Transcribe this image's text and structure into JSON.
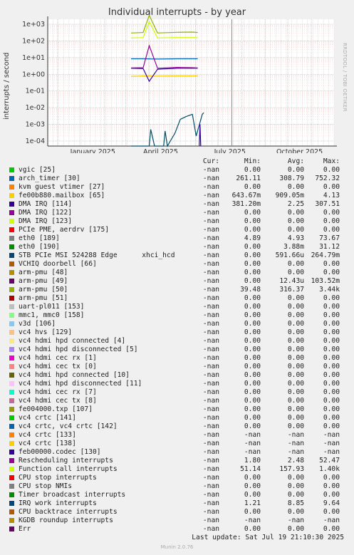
{
  "title": "Individual interrupts - by year",
  "side_label": "RRDTOOL / TOBI OETIKER",
  "ylabel": "interrupts / second",
  "columns": {
    "cur": "Cur:",
    "min": "Min:",
    "avg": "Avg:",
    "max": "Max:"
  },
  "last_update": "Last update: Sat Jul 19 21:10:30 2025",
  "footer": "Munin 2.0.76",
  "chart_data": {
    "type": "line",
    "title": "Individual interrupts - by year",
    "ylabel": "interrupts / second",
    "y_scale": "log",
    "ylim": [
      5e-05,
      2000
    ],
    "y_ticks": [
      "1e-04",
      "1e-03",
      "1e-02",
      "1e-01",
      "1e+00",
      "1e+01",
      "1e+02",
      "1e+03"
    ],
    "y_tick_values": [
      0.0001,
      0.001,
      0.01,
      0.1,
      1,
      10,
      100,
      1000
    ],
    "x_ticks": [
      "January 2025",
      "April 2025",
      "July 2025",
      "October 2025"
    ],
    "grid": true,
    "series": [
      {
        "name": "arch_timer [30]",
        "color": "#0066b3",
        "points": [
          [
            "2025-03-08",
            8.5
          ],
          [
            "2025-03-24",
            8.5
          ],
          [
            "2025-04-12",
            8.2
          ],
          [
            "2025-05-08",
            8.5
          ],
          [
            "2025-05-28",
            8.5
          ],
          [
            "2025-06-04",
            8.5
          ]
        ]
      },
      {
        "name": "fe00b880.mailbox [65]",
        "color": "#ffcc00",
        "points": [
          [
            "2025-03-08",
            0.75
          ],
          [
            "2025-03-24",
            0.8
          ],
          [
            "2025-04-12",
            0.78
          ],
          [
            "2025-05-08",
            0.8
          ],
          [
            "2025-05-28",
            0.8
          ],
          [
            "2025-06-04",
            0.8
          ]
        ]
      },
      {
        "name": "DMA IRQ [114]",
        "color": "#330099",
        "points": [
          [
            "2025-03-08",
            2.3
          ],
          [
            "2025-03-24",
            2.2
          ],
          [
            "2025-04-01",
            0.38
          ],
          [
            "2025-04-12",
            2.0
          ],
          [
            "2025-05-08",
            2.3
          ],
          [
            "2025-05-28",
            2.3
          ],
          [
            "2025-06-04",
            2.3
          ]
        ]
      },
      {
        "name": "arm-pmu [50]",
        "color": "#8fb300",
        "points": [
          [
            "2025-03-08",
            300
          ],
          [
            "2025-03-24",
            320
          ],
          [
            "2025-04-01",
            3440
          ],
          [
            "2025-04-12",
            300
          ],
          [
            "2025-05-08",
            330
          ],
          [
            "2025-05-28",
            340
          ],
          [
            "2025-06-04",
            320
          ]
        ]
      },
      {
        "name": "Function call interrupts",
        "color": "#ccff00",
        "points": [
          [
            "2025-03-08",
            150
          ],
          [
            "2025-03-24",
            160
          ],
          [
            "2025-04-01",
            1400
          ],
          [
            "2025-04-12",
            150
          ],
          [
            "2025-05-08",
            160
          ],
          [
            "2025-05-28",
            160
          ],
          [
            "2025-06-04",
            155
          ]
        ]
      },
      {
        "name": "Rescheduling interrupts",
        "color": "#990099",
        "points": [
          [
            "2025-03-08",
            2.4
          ],
          [
            "2025-03-24",
            2.5
          ],
          [
            "2025-04-01",
            52
          ],
          [
            "2025-04-12",
            2.3
          ],
          [
            "2025-05-08",
            2.6
          ],
          [
            "2025-05-28",
            2.5
          ],
          [
            "2025-06-04",
            2.4
          ]
        ]
      },
      {
        "name": "STB PCIe MSI 524288 Edge      xhci_hcd",
        "color": "#004d66",
        "points": [
          [
            "2025-03-08",
            5e-05
          ],
          [
            "2025-04-01",
            5e-05
          ],
          [
            "2025-04-03",
            0.0005
          ],
          [
            "2025-04-08",
            5e-05
          ],
          [
            "2025-04-20",
            5e-05
          ],
          [
            "2025-04-22",
            0.0004
          ],
          [
            "2025-04-25",
            5e-05
          ],
          [
            "2025-05-05",
            0.0003
          ],
          [
            "2025-05-12",
            0.002
          ],
          [
            "2025-05-20",
            0.003
          ],
          [
            "2025-05-28",
            0.004
          ],
          [
            "2025-06-02",
            0.0002
          ],
          [
            "2025-06-10",
            0.004
          ],
          [
            "2025-06-12",
            0.005
          ]
        ]
      },
      {
        "name": "arm-pmu [49]",
        "color": "#330099",
        "points": [
          [
            "2025-06-06",
            5e-05
          ],
          [
            "2025-06-07",
            0.001
          ],
          [
            "2025-06-08",
            5e-05
          ]
        ]
      }
    ]
  },
  "legend": [
    {
      "name": "vgic [25]",
      "color": "#00cc00",
      "cur": "-nan",
      "min": "0.00",
      "avg": "0.00",
      "max": "0.00"
    },
    {
      "name": "arch_timer [30]",
      "color": "#0066b3",
      "cur": "-nan",
      "min": "261.11",
      "avg": "308.79",
      "max": "752.32"
    },
    {
      "name": "kvm guest vtimer [27]",
      "color": "#ff8000",
      "cur": "-nan",
      "min": "0.00",
      "avg": "0.00",
      "max": "0.00"
    },
    {
      "name": "fe00b880.mailbox [65]",
      "color": "#ffcc00",
      "cur": "-nan",
      "min": "643.67m",
      "avg": "909.05m",
      "max": "4.13"
    },
    {
      "name": "DMA IRQ [114]",
      "color": "#330099",
      "cur": "-nan",
      "min": "381.20m",
      "avg": "2.25",
      "max": "307.51"
    },
    {
      "name": "DMA IRQ [122]",
      "color": "#990099",
      "cur": "-nan",
      "min": "0.00",
      "avg": "0.00",
      "max": "0.00"
    },
    {
      "name": "DMA IRQ [123]",
      "color": "#ccff00",
      "cur": "-nan",
      "min": "0.00",
      "avg": "0.00",
      "max": "0.00"
    },
    {
      "name": "PCIe PME, aerdrv [175]",
      "color": "#ff0000",
      "cur": "-nan",
      "min": "0.00",
      "avg": "0.00",
      "max": "0.00"
    },
    {
      "name": "eth0 [189]",
      "color": "#808080",
      "cur": "-nan",
      "min": "4.89",
      "avg": "4.93",
      "max": "73.67"
    },
    {
      "name": "eth0 [190]",
      "color": "#008f00",
      "cur": "-nan",
      "min": "0.00",
      "avg": "3.88m",
      "max": "31.12"
    },
    {
      "name": "STB PCIe MSI 524288 Edge      xhci_hcd",
      "color": "#00487d",
      "cur": "-nan",
      "min": "0.00",
      "avg": "591.66u",
      "max": "264.79m"
    },
    {
      "name": "VCHIQ doorbell [66]",
      "color": "#b35a00",
      "cur": "-nan",
      "min": "0.00",
      "avg": "0.00",
      "max": "0.00"
    },
    {
      "name": "arm-pmu [48]",
      "color": "#b38f00",
      "cur": "-nan",
      "min": "0.00",
      "avg": "0.00",
      "max": "0.00"
    },
    {
      "name": "arm-pmu [49]",
      "color": "#6b006b",
      "cur": "-nan",
      "min": "0.00",
      "avg": "12.43u",
      "max": "103.52m"
    },
    {
      "name": "arm-pmu [50]",
      "color": "#8fb300",
      "cur": "-nan",
      "min": "39.48",
      "avg": "316.37",
      "max": "3.44k"
    },
    {
      "name": "arm-pmu [51]",
      "color": "#b30000",
      "cur": "-nan",
      "min": "0.00",
      "avg": "0.00",
      "max": "0.00"
    },
    {
      "name": "uart-pl011 [153]",
      "color": "#bebebe",
      "cur": "-nan",
      "min": "0.00",
      "avg": "0.00",
      "max": "0.00"
    },
    {
      "name": "mmc1, mmc0 [158]",
      "color": "#80ff80",
      "cur": "-nan",
      "min": "0.00",
      "avg": "0.00",
      "max": "0.00"
    },
    {
      "name": "v3d [106]",
      "color": "#80c9ff",
      "cur": "-nan",
      "min": "0.00",
      "avg": "0.00",
      "max": "0.00"
    },
    {
      "name": "vc4 hvs [129]",
      "color": "#ffc080",
      "cur": "-nan",
      "min": "0.00",
      "avg": "0.00",
      "max": "0.00"
    },
    {
      "name": "vc4 hdmi hpd connected [4]",
      "color": "#ffe680",
      "cur": "-nan",
      "min": "0.00",
      "avg": "0.00",
      "max": "0.00"
    },
    {
      "name": "vc4 hdmi hpd disconnected [5]",
      "color": "#aa80ff",
      "cur": "-nan",
      "min": "0.00",
      "avg": "0.00",
      "max": "0.00"
    },
    {
      "name": "vc4 hdmi cec rx [1]",
      "color": "#ee00cc",
      "cur": "-nan",
      "min": "0.00",
      "avg": "0.00",
      "max": "0.00"
    },
    {
      "name": "vc4 hdmi cec tx [0]",
      "color": "#ff8080",
      "cur": "-nan",
      "min": "0.00",
      "avg": "0.00",
      "max": "0.00"
    },
    {
      "name": "vc4 hdmi hpd connected [10]",
      "color": "#666600",
      "cur": "-nan",
      "min": "0.00",
      "avg": "0.00",
      "max": "0.00"
    },
    {
      "name": "vc4 hdmi hpd disconnected [11]",
      "color": "#ffbfff",
      "cur": "-nan",
      "min": "0.00",
      "avg": "0.00",
      "max": "0.00"
    },
    {
      "name": "vc4 hdmi cec rx [7]",
      "color": "#00ffcc",
      "cur": "-nan",
      "min": "0.00",
      "avg": "0.00",
      "max": "0.00"
    },
    {
      "name": "vc4 hdmi cec tx [8]",
      "color": "#cc6699",
      "cur": "-nan",
      "min": "0.00",
      "avg": "0.00",
      "max": "0.00"
    },
    {
      "name": "fe004000.txp [107]",
      "color": "#999900",
      "cur": "-nan",
      "min": "0.00",
      "avg": "0.00",
      "max": "0.00"
    },
    {
      "name": "vc4 crtc [141]",
      "color": "#00cc00",
      "cur": "-nan",
      "min": "0.00",
      "avg": "0.00",
      "max": "0.00"
    },
    {
      "name": "vc4 crtc, vc4 crtc [142]",
      "color": "#0066b3",
      "cur": "-nan",
      "min": "0.00",
      "avg": "0.00",
      "max": "0.00"
    },
    {
      "name": "vc4 crtc [133]",
      "color": "#ff8000",
      "cur": "-nan",
      "min": "-nan",
      "avg": "-nan",
      "max": "-nan"
    },
    {
      "name": "vc4 crtc [138]",
      "color": "#ffcc00",
      "cur": "-nan",
      "min": "-nan",
      "avg": "-nan",
      "max": "-nan"
    },
    {
      "name": "feb00000.codec [130]",
      "color": "#330099",
      "cur": "-nan",
      "min": "-nan",
      "avg": "-nan",
      "max": "-nan"
    },
    {
      "name": "Rescheduling interrupts",
      "color": "#990099",
      "cur": "-nan",
      "min": "1.80",
      "avg": "2.48",
      "max": "52.47"
    },
    {
      "name": "Function call interrupts",
      "color": "#ccff00",
      "cur": "-nan",
      "min": "51.14",
      "avg": "157.93",
      "max": "1.40k"
    },
    {
      "name": "CPU stop interrupts",
      "color": "#ff0000",
      "cur": "-nan",
      "min": "0.00",
      "avg": "0.00",
      "max": "0.00"
    },
    {
      "name": "CPU stop NMIs",
      "color": "#808080",
      "cur": "-nan",
      "min": "0.00",
      "avg": "0.00",
      "max": "0.00"
    },
    {
      "name": "Timer broadcast interrupts",
      "color": "#008f00",
      "cur": "-nan",
      "min": "0.00",
      "avg": "0.00",
      "max": "0.00"
    },
    {
      "name": "IRQ work interrupts",
      "color": "#00487d",
      "cur": "-nan",
      "min": "1.21",
      "avg": "8.85",
      "max": "9.64"
    },
    {
      "name": "CPU backtrace interrupts",
      "color": "#b35a00",
      "cur": "-nan",
      "min": "0.00",
      "avg": "0.00",
      "max": "0.00"
    },
    {
      "name": "KGDB roundup interrupts",
      "color": "#b38f00",
      "cur": "-nan",
      "min": "-nan",
      "avg": "-nan",
      "max": "-nan"
    },
    {
      "name": "Err",
      "color": "#6b006b",
      "cur": "-nan",
      "min": "0.00",
      "avg": "0.00",
      "max": "0.00"
    }
  ]
}
